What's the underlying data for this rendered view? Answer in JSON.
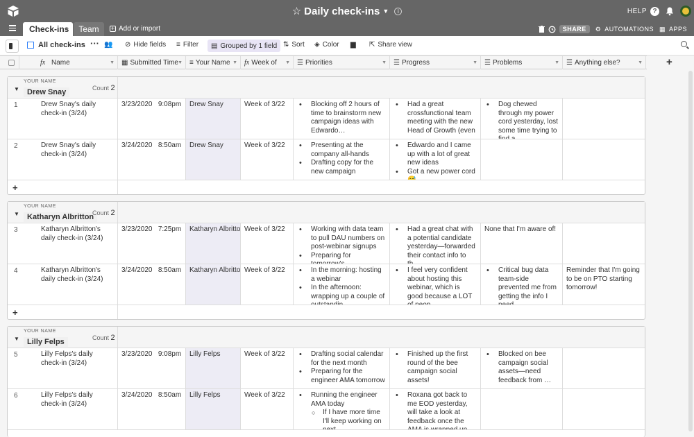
{
  "base": {
    "title": "Daily check-ins"
  },
  "topbar": {
    "help_label": "HELP"
  },
  "tabs": [
    {
      "label": "Check-ins"
    },
    {
      "label": "Team"
    }
  ],
  "add_import_label": "Add or import",
  "toolbar_right": {
    "share_label": "SHARE",
    "automations_label": "AUTOMATIONS",
    "apps_label": "APPS"
  },
  "view": {
    "name": "All check-ins",
    "hide_fields": "Hide fields",
    "filter": "Filter",
    "grouped": "Grouped by 1 field",
    "sort": "Sort",
    "color": "Color",
    "share_view": "Share view"
  },
  "columns": [
    "Name",
    "Submitted Time",
    "Your Name",
    "Week of",
    "Priorities",
    "Progress",
    "Problems",
    "Anything else?"
  ],
  "groups": [
    {
      "key": "YOUR NAME",
      "value": "Drew Snay",
      "count_label": "Count",
      "count": "2",
      "rows": [
        {
          "num": "1",
          "name": "Drew Snay's daily check-in (3/24)",
          "date": "3/23/2020",
          "time": "9:08pm",
          "person": "Drew Snay",
          "week": "Week of 3/22",
          "priorities": [
            "Blocking off 2 hours of time to brainstorm new campaign ideas with Edwardo…"
          ],
          "progress": [
            "Had a great crossfunctional team meeting with the new Head of Growth (even …"
          ],
          "problems": [
            "Dog chewed through my power cord yesterday, lost some time trying to find a …"
          ],
          "anything": ""
        },
        {
          "num": "2",
          "name": "Drew Snay's daily check-in (3/24)",
          "date": "3/24/2020",
          "time": "8:50am",
          "person": "Drew Snay",
          "week": "Week of 3/22",
          "priorities": [
            "Presenting at the company all-hands",
            "Drafting copy for the new campaign"
          ],
          "progress": [
            "Edwardo and I came up with a lot of great new ideas",
            "Got a new power cord 😅"
          ],
          "problems": [],
          "anything": ""
        }
      ]
    },
    {
      "key": "YOUR NAME",
      "value": "Katharyn Albritton",
      "count_label": "Count",
      "count": "2",
      "rows": [
        {
          "num": "3",
          "name": "Katharyn Albritton's daily check-in (3/24)",
          "date": "3/23/2020",
          "time": "7:25pm",
          "person": "Katharyn Albritton",
          "week": "Week of 3/22",
          "priorities": [
            "Working with data team to pull DAU numbers on post-webinar signups",
            "Preparing for tomorrow's …"
          ],
          "progress": [
            "Had a great chat with a potential candidate yesterday—forwarded their contact info to th…"
          ],
          "problems_text": "None that I'm aware of!",
          "problems": [],
          "anything": ""
        },
        {
          "num": "4",
          "name": "Katharyn Albritton's daily check-in (3/24)",
          "date": "3/24/2020",
          "time": "8:50am",
          "person": "Katharyn Albritton",
          "week": "Week of 3/22",
          "priorities": [
            "In the morning: hosting a webinar",
            "In the afternoon: wrapping up a couple of outstandin…"
          ],
          "progress_text": "I feel very confident about hosting this webinar, which is good because a LOT of peop…",
          "progress": [],
          "problems": [
            "Critical bug data team-side prevented me from getting the info I need"
          ],
          "anything": "Reminder that I'm going to be on PTO starting tomorrow!"
        }
      ]
    },
    {
      "key": "YOUR NAME",
      "value": "Lilly Felps",
      "count_label": "Count",
      "count": "2",
      "rows": [
        {
          "num": "5",
          "name": "Lilly Felps's daily check-in (3/24)",
          "date": "3/23/2020",
          "time": "9:08pm",
          "person": "Lilly Felps",
          "week": "Week of 3/22",
          "priorities": [
            "Drafting social calendar for the next month",
            "Preparing for the engineer AMA tomorrow"
          ],
          "progress_text": "Finished up the first round of the bee campaign social assets!",
          "progress": [],
          "problems": [
            "Blocked on bee campaign social assets—need feedback from …"
          ],
          "anything": ""
        },
        {
          "num": "6",
          "name": "Lilly Felps's daily check-in (3/24)",
          "date": "3/24/2020",
          "time": "8:50am",
          "person": "Lilly Felps",
          "week": "Week of 3/22",
          "priorities": [
            "Running the engineer AMA today"
          ],
          "priorities_sub": [
            "If I have more time I'll keep working on next…"
          ],
          "progress_text": "Roxana got back to me EOD yesterday, will take a look at feedback once the AMA is wrapped up",
          "progress": [],
          "problems": [],
          "anything": ""
        }
      ]
    }
  ],
  "icons": {
    "add_row": "+",
    "add_field": "+"
  }
}
